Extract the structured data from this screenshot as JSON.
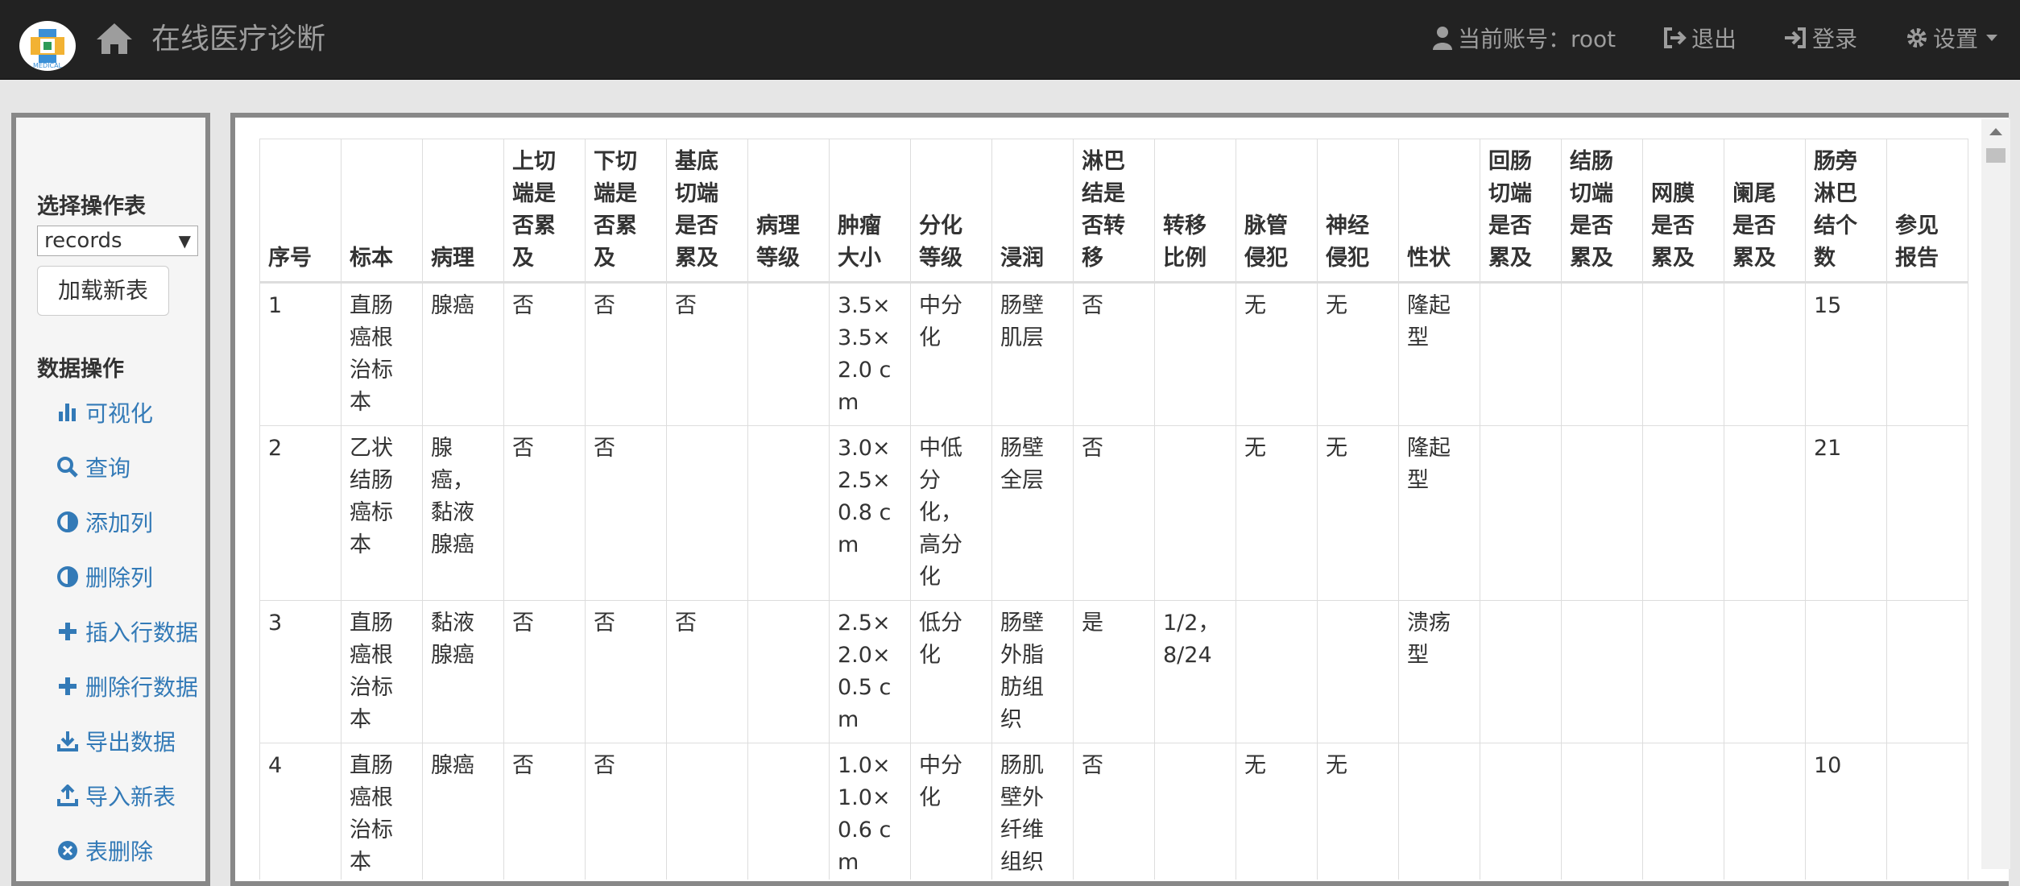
{
  "navbar": {
    "brand": "在线医疗诊断",
    "logo_text": "MEDICAL",
    "account_label": "当前账号：root",
    "logout_label": "退出",
    "login_label": "登录",
    "settings_label": "设置"
  },
  "sidebar": {
    "select_table_title": "选择操作表",
    "selected_table": "records",
    "load_button": "加载新表",
    "data_ops_title": "数据操作",
    "items": [
      {
        "label": "可视化",
        "icon": "bar-chart-icon"
      },
      {
        "label": "查询",
        "icon": "search-icon"
      },
      {
        "label": "添加列",
        "icon": "half-circle-icon"
      },
      {
        "label": "删除列",
        "icon": "half-circle-icon"
      },
      {
        "label": "插入行数据",
        "icon": "plus-icon"
      },
      {
        "label": "删除行数据",
        "icon": "plus-icon"
      },
      {
        "label": "导出数据",
        "icon": "download-icon"
      },
      {
        "label": "导入新表",
        "icon": "upload-icon"
      },
      {
        "label": "表删除",
        "icon": "remove-circle-icon"
      }
    ]
  },
  "table": {
    "columns": [
      "序号",
      "标本",
      "病理",
      "上切端是否累及",
      "下切端是否累及",
      "基底切端是否累及",
      "病理等级",
      "肿瘤大小",
      "分化等级",
      "浸润",
      "淋巴结是否转移",
      "转移比例",
      "脉管侵犯",
      "神经侵犯",
      "性状",
      "回肠切端是否累及",
      "结肠切端是否累及",
      "网膜是否累及",
      "阑尾是否累及",
      "肠旁淋巴结个数",
      "参见报告"
    ],
    "rows": [
      [
        "1",
        "直肠癌根治标本",
        "腺癌",
        "否",
        "否",
        "否",
        "",
        "3.5×3.5×2.0 cm",
        "中分化",
        "肠壁肌层",
        "否",
        "",
        "无",
        "无",
        "隆起型",
        "",
        "",
        "",
        "",
        "15",
        ""
      ],
      [
        "2",
        "乙状结肠癌标本",
        "腺癌，黏液腺癌",
        "否",
        "否",
        "",
        "",
        "3.0×2.5×0.8 cm",
        "中低分化，高分化",
        "肠壁全层",
        "否",
        "",
        "无",
        "无",
        "隆起型",
        "",
        "",
        "",
        "",
        "21",
        ""
      ],
      [
        "3",
        "直肠癌根治标本",
        "黏液腺癌",
        "否",
        "否",
        "否",
        "",
        "2.5×2.0×0.5 cm",
        "低分化",
        "肠壁外脂肪组织",
        "是",
        "1/2，8/24",
        "",
        "",
        "溃疡型",
        "",
        "",
        "",
        "",
        "",
        ""
      ],
      [
        "4",
        "直肠癌根治标本",
        "腺癌",
        "否",
        "否",
        "",
        "",
        "1.0×1.0×0.6 cm",
        "中分化",
        "肠肌壁外纤维组织",
        "否",
        "",
        "无",
        "无",
        "",
        "",
        "",
        "",
        "",
        "10",
        ""
      ]
    ]
  },
  "colors": {
    "navbar_bg": "#222222",
    "navbar_text": "#9d9d9d",
    "link": "#337ab7"
  }
}
